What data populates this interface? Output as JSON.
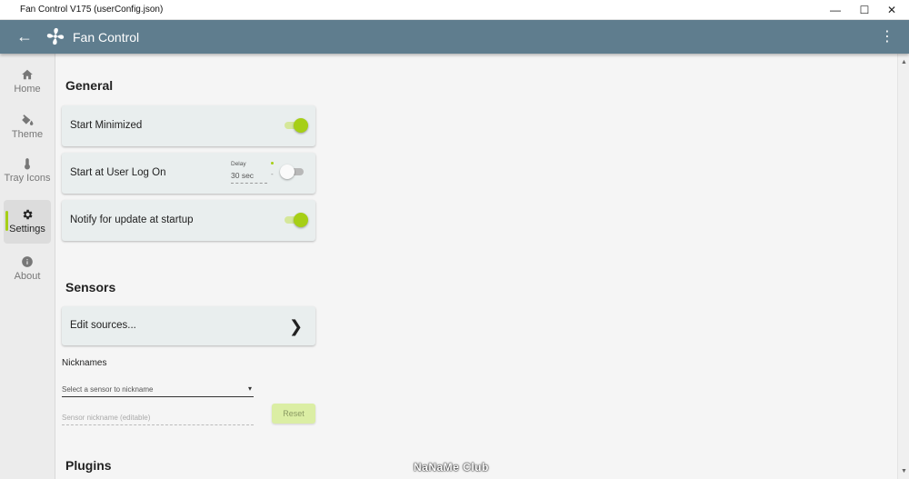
{
  "window": {
    "title": "Fan Control V175 (userConfig.json)",
    "min_glyph": "—",
    "max_glyph": "☐",
    "close_glyph": "✕"
  },
  "appbar": {
    "title": "Fan Control",
    "back_glyph": "←",
    "menu_glyph": "⋮",
    "color": "#5f7d8e"
  },
  "sidebar": {
    "items": [
      {
        "label": "Home",
        "icon": "home-icon"
      },
      {
        "label": "Theme",
        "icon": "paint-bucket-icon"
      },
      {
        "label": "Tray Icons",
        "icon": "thermometer-icon"
      },
      {
        "label": "Settings",
        "icon": "gear-icon",
        "active": true
      },
      {
        "label": "About",
        "icon": "info-icon"
      }
    ]
  },
  "general": {
    "title": "General",
    "start_minimized": {
      "label": "Start Minimized",
      "on": true
    },
    "start_logon": {
      "label": "Start at User Log On",
      "on": false,
      "delay_label": "Delay",
      "delay_value": "30 sec",
      "delay_suffix": "-"
    },
    "notify_update": {
      "label": "Notify for update at startup",
      "on": true
    }
  },
  "sensors": {
    "title": "Sensors",
    "edit_sources": "Edit sources...",
    "chevron": "❯",
    "nicknames_label": "Nicknames",
    "select_placeholder": "Select a sensor to nickname",
    "select_arrow": "▾",
    "nickname_placeholder": "Sensor nickname (editable)",
    "reset_label": "Reset"
  },
  "plugins": {
    "title": "Plugins"
  },
  "watermark": "NaNaMe Club",
  "scroll": {
    "up": "▲",
    "down": "▼"
  },
  "accent_color": "#a6cf16"
}
